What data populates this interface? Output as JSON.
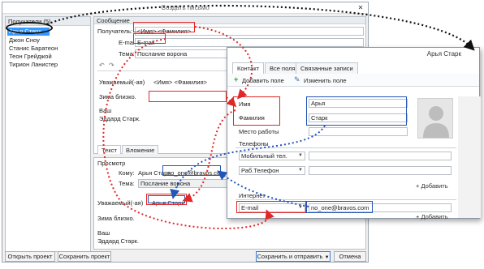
{
  "main_window": {
    "title": "Создать письмо",
    "recipients_header": "Получатели (5)",
    "recipients": [
      "Арья Старк",
      "Джон Сноу",
      "Станис Баратеон",
      "Теон Грейджой",
      "Тирион Ланистер"
    ],
    "message_section": "Сообщение",
    "to_label": "Получатель:",
    "to_value": "<Имя> <Фамилия>",
    "email_label": "E-mail",
    "email_value": "E-mail",
    "subject_label": "Тема:",
    "subject_value": "Послание ворона",
    "body_greeting": "Уважаемый(-ая)",
    "body_placeholder": "<Имя> <Фамилия>",
    "body_line2": "Зима близко.",
    "body_sign1": "Ваш",
    "body_sign2": "Эддард Старк.",
    "tab_text": "Текст",
    "tab_attach": "Вложение",
    "preview_section": "Просмотр",
    "preview_to_label": "Кому:",
    "preview_to_name": "Арья Старк",
    "preview_to_email": "no_one@bravos.com",
    "preview_subject_label": "Тема:",
    "preview_subject_value": "Послание ворона",
    "preview_greeting": "Уважаемый(-ая)",
    "preview_name": "Арья Старк",
    "preview_line2": "Зима близко.",
    "preview_sign1": "Ваш",
    "preview_sign2": "Эддард Старк.",
    "btn_open": "Открыть проект",
    "btn_save": "Сохранить проект",
    "btn_send": "Сохранить и отправить",
    "btn_cancel": "Отмена"
  },
  "contact_window": {
    "title": "Арья Старк",
    "tabs": [
      "Контакт",
      "Все поля",
      "Связанные записи"
    ],
    "add_field": "Добавить поле",
    "edit_field": "Изменить поле",
    "first_name_label": "Имя",
    "first_name_value": "Арья",
    "last_name_label": "Фамилия",
    "last_name_value": "Старк",
    "workplace_label": "Место работы",
    "phones_header": "Телефоны",
    "phone1_type": "Мобильный тел.",
    "phone2_type": "Раб.Телефон",
    "add_label": "Добавить",
    "internet_header": "Интернет",
    "email_type": "E-mail",
    "email_value": "no_one@bravos.com"
  },
  "colors": {
    "annotation_red": "#e02828",
    "annotation_blue": "#2255b8",
    "annotation_black": "#111111"
  }
}
